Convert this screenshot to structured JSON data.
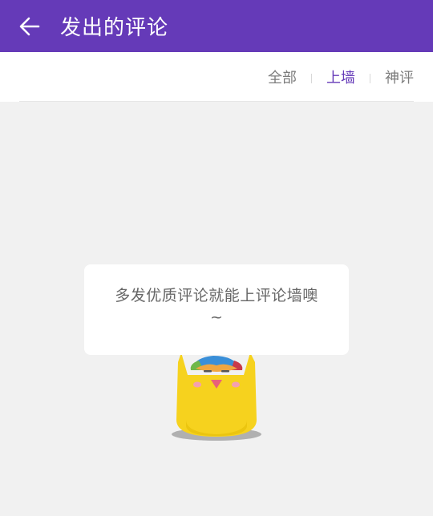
{
  "header": {
    "back_icon": "arrow-left-icon",
    "title": "发出的评论",
    "background_color": "#653ab8"
  },
  "filter": {
    "tabs": [
      {
        "label": "全部",
        "active": false
      },
      {
        "label": "上墙",
        "active": true
      },
      {
        "label": "神评",
        "active": false
      }
    ],
    "active_color": "#653ab8"
  },
  "empty_state": {
    "message_line1": "多发优质评论就能上评论墙噢",
    "message_line2": "~",
    "mascot_icon": "yellow-cat-mascot-icon"
  }
}
